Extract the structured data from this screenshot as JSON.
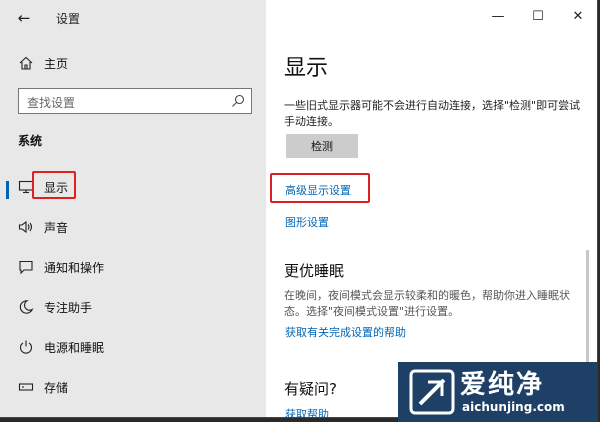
{
  "window": {
    "title": "设置"
  },
  "titlebar": {
    "minimize": "—",
    "maximize": "☐",
    "close": "✕"
  },
  "sidebar": {
    "home": {
      "label": "主页",
      "icon": "home-icon"
    },
    "search": {
      "placeholder": "查找设置"
    },
    "section": "系统",
    "items": [
      {
        "label": "显示",
        "icon": "monitor-icon",
        "selected": true
      },
      {
        "label": "声音",
        "icon": "speaker-icon"
      },
      {
        "label": "通知和操作",
        "icon": "notification-icon"
      },
      {
        "label": "专注助手",
        "icon": "moon-icon"
      },
      {
        "label": "电源和睡眠",
        "icon": "power-icon"
      },
      {
        "label": "存储",
        "icon": "storage-icon"
      }
    ]
  },
  "main": {
    "title": "显示",
    "description": "一些旧式显示器可能不会进行自动连接，选择\"检测\"即可尝试手动连接。",
    "detect_button": "检测",
    "advanced_link": "高级显示设置",
    "graphics_link": "图形设置",
    "sleep_heading": "更优睡眠",
    "sleep_desc": "在晚间，夜间模式会显示较柔和的暖色，帮助你进入睡眠状态。选择\"夜间模式设置\"进行设置。",
    "sleep_link": "获取有关完成设置的帮助",
    "question_heading": "有疑问?",
    "help_link": "获取帮助"
  },
  "watermark": {
    "text": "爱纯净",
    "url": "aichunjing.com"
  },
  "colors": {
    "accent": "#0066b4",
    "highlight_box": "#e02020",
    "sidebar_bg": "#e8e8e8"
  }
}
